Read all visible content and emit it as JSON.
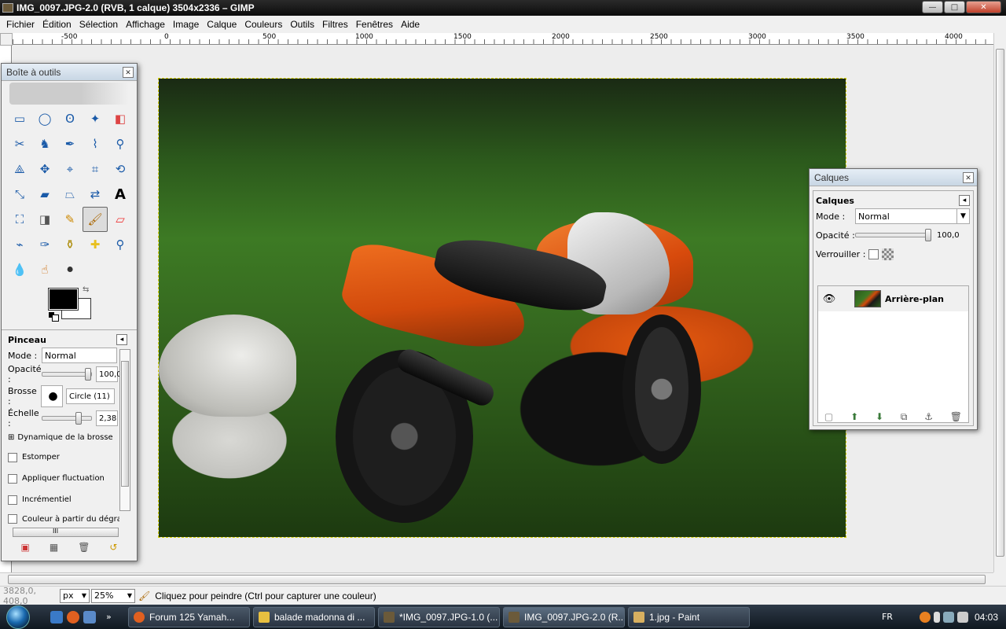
{
  "window": {
    "title": "IMG_0097.JPG-2.0 (RVB, 1 calque) 3504x2336 – GIMP",
    "buttons": {
      "minimize": "—",
      "maximize": "□",
      "close": "✕"
    }
  },
  "menu": [
    {
      "label": "Fichier"
    },
    {
      "label": "Édition"
    },
    {
      "label": "Sélection"
    },
    {
      "label": "Affichage"
    },
    {
      "label": "Image"
    },
    {
      "label": "Calque"
    },
    {
      "label": "Couleurs"
    },
    {
      "label": "Outils"
    },
    {
      "label": "Filtres"
    },
    {
      "label": "Fenêtres"
    },
    {
      "label": "Aide"
    }
  ],
  "ruler": {
    "labels": [
      "-500",
      "0",
      "500",
      "1000",
      "1500",
      "2000",
      "2500",
      "3000",
      "3500",
      "4000"
    ]
  },
  "toolbox": {
    "title": "Boîte à outils",
    "tools": [
      "rect-select",
      "ellipse-select",
      "free-select",
      "fuzzy-select",
      "select-by-color",
      "scissors-select",
      "foreground-select",
      "paths",
      "color-picker",
      "zoom",
      "measure",
      "move",
      "align",
      "crop",
      "rotate",
      "scale",
      "shear",
      "perspective",
      "flip",
      "text",
      "bucket-fill",
      "blend",
      "pencil",
      "paintbrush",
      "eraser",
      "airbrush",
      "ink",
      "clone",
      "heal",
      "perspective-clone",
      "blur",
      "smudge",
      "dodge-burn"
    ],
    "active_tool": "paintbrush",
    "colors": {
      "foreground": "#000000",
      "background": "#ffffff"
    },
    "options": {
      "header": "Pinceau",
      "mode_label": "Mode :",
      "mode_value": "Normal",
      "opacity_label": "Opacité :",
      "opacity_value": "100,0",
      "opacity_fraction": 1.0,
      "brush_label": "Brosse :",
      "brush_value": "Circle (11)",
      "scale_label": "Échelle :",
      "scale_value": "2,38",
      "dynamics_label": "Dynamique de la brosse",
      "checkboxes": [
        "Estomper",
        "Appliquer fluctuation",
        "Incrémentiel",
        "Couleur à partir du dégradé"
      ],
      "scroll_mark": "III"
    }
  },
  "layers": {
    "title": "Calques",
    "header": "Calques",
    "mode_label": "Mode :",
    "mode_value": "Normal",
    "opacity_label": "Opacité :",
    "opacity_value": "100,0",
    "lock_label": "Verrouiller :",
    "items": [
      {
        "name": "Arrière-plan",
        "visible": true
      }
    ]
  },
  "statusbar": {
    "coords": "3828,0, 408,0",
    "unit": "px",
    "zoom": "25%",
    "message": "Cliquez pour peindre (Ctrl pour capturer une couleur)"
  },
  "taskbar": {
    "tasks": [
      {
        "label": "Forum 125 Yamah...",
        "color": "#e06020",
        "active": false
      },
      {
        "label": "balade madonna di ...",
        "color": "#e8c040",
        "active": false
      },
      {
        "label": "*IMG_0097.JPG-1.0 (...",
        "color": "#6b5a3a",
        "active": false
      },
      {
        "label": "IMG_0097.JPG-2.0 (R...",
        "color": "#6b5a3a",
        "active": true
      },
      {
        "label": "1.jpg - Paint",
        "color": "#d8b060",
        "active": false
      }
    ],
    "lang": "FR",
    "clock": "04:03",
    "overflow": "»"
  }
}
